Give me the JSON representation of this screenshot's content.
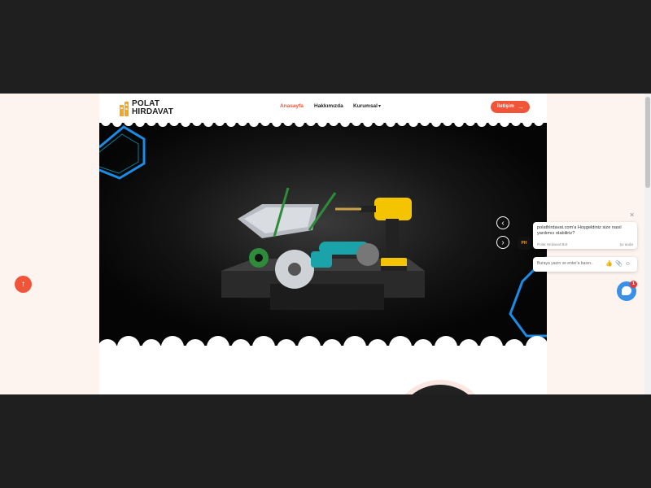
{
  "site": {
    "logo": {
      "line1": "POLAT",
      "line2": "HIRDAVAT"
    },
    "nav": [
      {
        "label": "Anasayfa",
        "active": true
      },
      {
        "label": "Hakkımızda",
        "active": false
      },
      {
        "label": "Kurumsal",
        "active": false,
        "dropdown": true
      }
    ],
    "cta_label": "İletişim",
    "brand_color": "#f0553a"
  },
  "hero": {
    "prev_icon": "chevron-left-icon",
    "next_icon": "chevron-right-icon"
  },
  "chat": {
    "message": "polathirdavat.com'a Hoşgeldiniz size nasıl yardımcı olabiliriz?",
    "sender": "Polat Hırdavat Bot",
    "time": "şu anda",
    "input_placeholder": "Buraya yazın ve enter'a basın..",
    "unread_count": "1",
    "accent_color": "#3a8fe6"
  }
}
